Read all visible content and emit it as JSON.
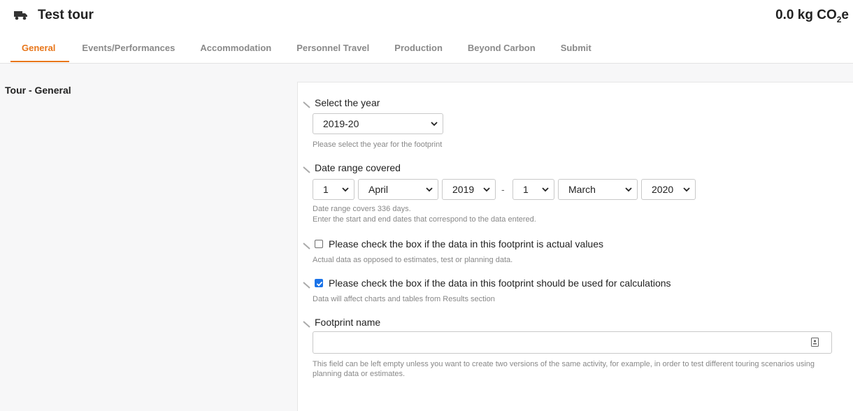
{
  "header": {
    "title": "Test tour",
    "icon": "truck-icon",
    "emissions_value": "0.0 kg CO",
    "emissions_sub": "2",
    "emissions_suffix": "e"
  },
  "tabs": [
    {
      "label": "General",
      "active": true
    },
    {
      "label": "Events/Performances"
    },
    {
      "label": "Accommodation"
    },
    {
      "label": "Personnel Travel"
    },
    {
      "label": "Production"
    },
    {
      "label": "Beyond Carbon"
    },
    {
      "label": "Submit"
    }
  ],
  "section": {
    "title": "Tour - General"
  },
  "form": {
    "year": {
      "label": "Select the year",
      "value": "2019-20",
      "help": "Please select the year for the footprint"
    },
    "date_range": {
      "label": "Date range covered",
      "start_day": "1",
      "start_month": "April",
      "start_year": "2019",
      "separator": "-",
      "end_day": "1",
      "end_month": "March",
      "end_year": "2020",
      "help_line1": "Date range covers 336 days.",
      "help_line2": "Enter the start and end dates that correspond to the data entered."
    },
    "actual_values": {
      "label": "Please check the box if the data in this footprint is actual values",
      "checked": false,
      "help": "Actual data as opposed to estimates, test or planning data."
    },
    "use_for_calculations": {
      "label": "Please check the box if the data in this footprint should be used for calculations",
      "checked": true,
      "help": "Data will affect charts and tables from Results section"
    },
    "footprint_name": {
      "label": "Footprint name",
      "value": "",
      "help": "This field can be left empty unless you want to create two versions of the same activity, for example, in order to test different touring scenarios using planning data or estimates."
    }
  },
  "colors": {
    "accent": "#e8761a",
    "checkbox": "#1a73e8"
  }
}
